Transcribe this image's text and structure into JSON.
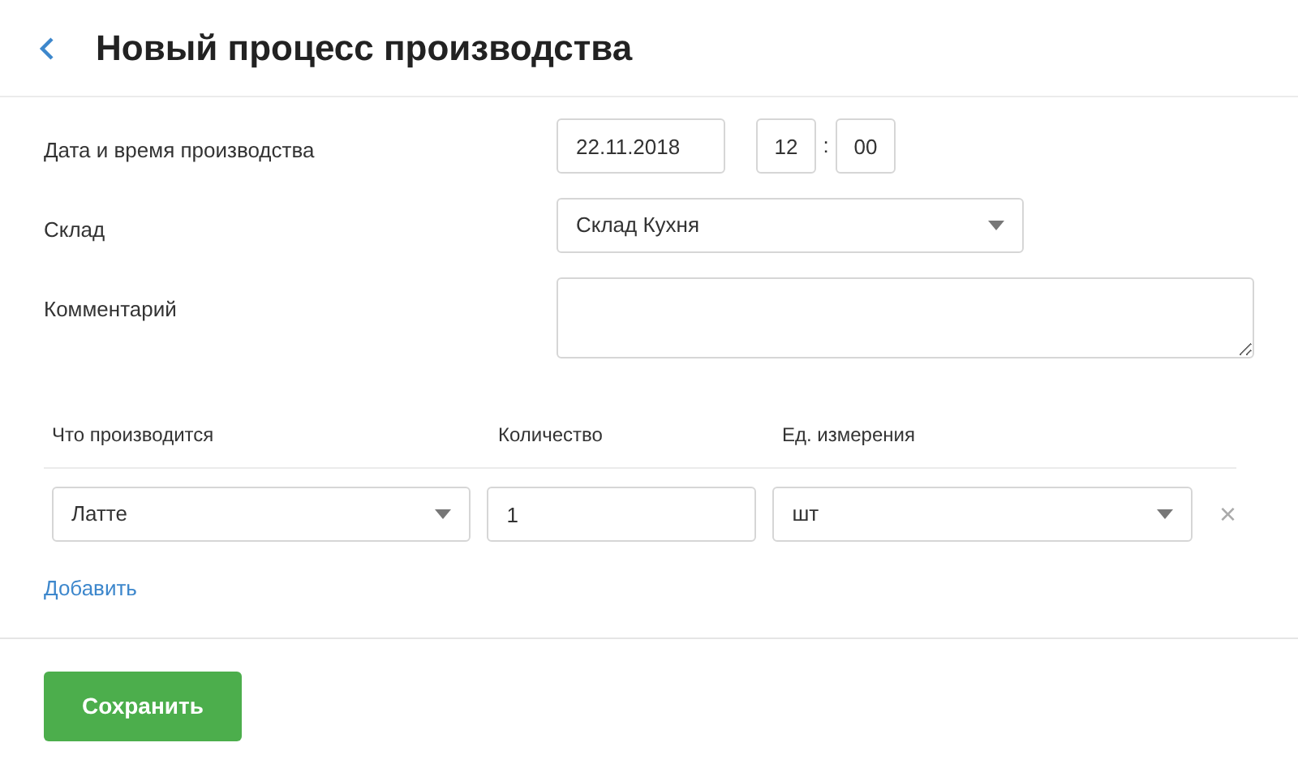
{
  "header": {
    "title": "Новый процесс производства"
  },
  "form": {
    "datetime": {
      "label": "Дата и время производства",
      "date": "22.11.2018",
      "hour": "12",
      "separator": ":",
      "minute": "00"
    },
    "warehouse": {
      "label": "Склад",
      "value": "Склад Кухня"
    },
    "comment": {
      "label": "Комментарий"
    }
  },
  "items_table": {
    "columns": [
      "Что производится",
      "Количество",
      "Ед. измерения"
    ],
    "rows": [
      {
        "product": "Латте",
        "quantity": "1",
        "unit": "шт",
        "remove": "×"
      }
    ]
  },
  "add_link": "Добавить",
  "save_button": "Сохранить"
}
